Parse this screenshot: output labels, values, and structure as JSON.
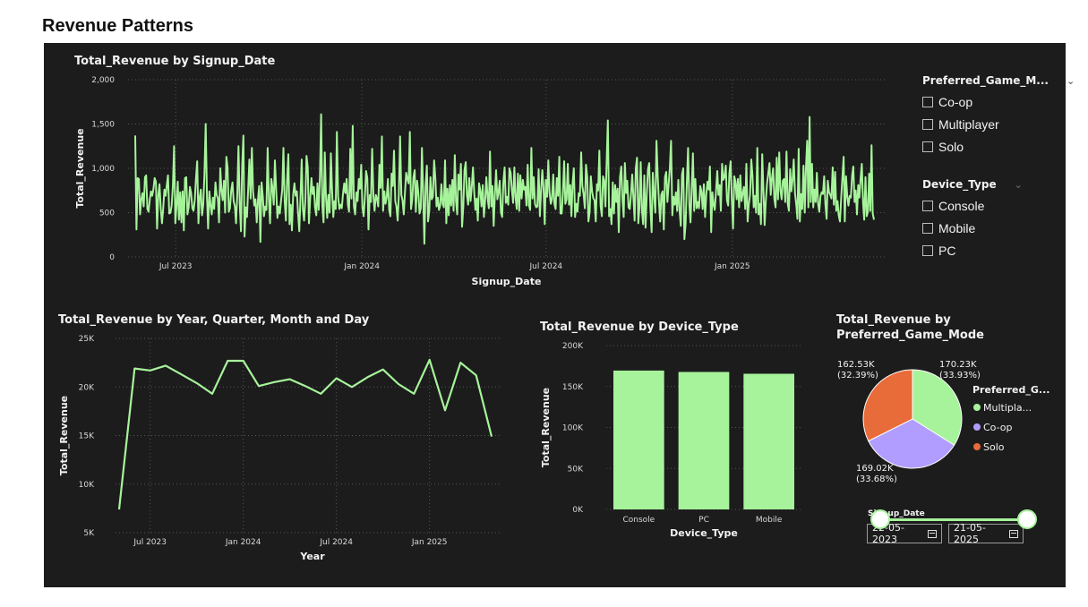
{
  "page": {
    "title": "Revenue Patterns"
  },
  "colors": {
    "green": "#a7f39b",
    "purple": "#b19cff",
    "orange": "#e86b3a",
    "background": "#1c1c1c"
  },
  "slicers": {
    "game_mode": {
      "title": "Preferred_Game_M...",
      "items": [
        "Co-op",
        "Multiplayer",
        "Solo"
      ]
    },
    "device_type": {
      "title": "Device_Type",
      "items": [
        "Console",
        "Mobile",
        "PC"
      ]
    },
    "signup_date": {
      "title": "Signup_Date",
      "start": "22-05-2023",
      "end": "21-05-2025"
    }
  },
  "chart_data": [
    {
      "id": "revenue-by-signup-date",
      "type": "line",
      "title": "Total_Revenue by Signup_Date",
      "xlabel": "Signup_Date",
      "ylabel": "Total_Revenue",
      "x_range": [
        "2023-05-22",
        "2025-05-21"
      ],
      "x_ticks": [
        "Jul 2023",
        "Jan 2024",
        "Jul 2024",
        "Jan 2025"
      ],
      "ylim": [
        0,
        2000
      ],
      "y_ticks": [
        "0",
        "500",
        "1,000",
        "1,500",
        "2,000"
      ],
      "series": [
        {
          "values": [
            1370,
            310,
            890,
            880,
            480,
            650,
            720,
            570,
            900,
            920,
            540,
            510,
            650,
            740,
            690,
            770,
            890,
            850,
            320,
            700,
            820,
            550,
            380,
            540,
            760,
            690,
            810,
            920,
            490,
            500,
            580,
            810,
            1250,
            380,
            570,
            850,
            420,
            730,
            390,
            740,
            300,
            890,
            900,
            480,
            560,
            790,
            720,
            550,
            520,
            640,
            880,
            1080,
            380,
            670,
            760,
            470,
            590,
            930,
            1500,
            690,
            320,
            740,
            590,
            480,
            670,
            540,
            840,
            700,
            660,
            390,
            1000,
            760,
            640,
            860,
            500,
            1130,
            1010,
            510,
            550,
            750,
            840,
            630,
            570,
            380,
            710,
            1250,
            600,
            290,
            1020,
            1370,
            230,
            560,
            450,
            780,
            1100,
            660,
            1230,
            740,
            580,
            650,
            390,
            630,
            800,
            170,
            840,
            680,
            460,
            570,
            530,
            1230,
            650,
            380,
            880,
            780,
            590,
            1090,
            760,
            440,
            570,
            490,
            630,
            760,
            1230,
            630,
            410,
            870,
            1160,
            370,
            590,
            300,
            700,
            830,
            690,
            740,
            500,
            290,
            650,
            1100,
            530,
            410,
            640,
            1140,
            1010,
            380,
            660,
            890,
            710,
            790,
            560,
            470,
            830,
            530,
            910,
            1610,
            570,
            390,
            1180,
            680,
            440,
            700,
            500,
            1170,
            760,
            450,
            630,
            540,
            1410,
            680,
            540,
            590,
            550,
            710,
            830,
            720,
            880,
            590,
            510,
            1220,
            660,
            1480,
            570,
            480,
            730,
            630,
            880,
            770,
            1040,
            560,
            460,
            680,
            970,
            890,
            310,
            700,
            620,
            1220,
            690,
            520,
            700,
            660,
            570,
            1040,
            780,
            1360,
            520,
            740,
            600,
            680,
            880,
            530,
            460,
            940,
            800,
            1200,
            630,
            570,
            410,
            700,
            1360,
            700,
            640,
            480,
            720,
            950,
            880,
            830,
            1410,
            540,
            650,
            900,
            980,
            510,
            860,
            720,
            490,
            550,
            1230,
            700,
            150,
            800,
            1030,
            400,
            520,
            900,
            650,
            680,
            1090,
            880,
            570,
            670,
            530,
            580,
            820,
            600,
            560,
            1090,
            380,
            770,
            470,
            810,
            580,
            870,
            520,
            1150,
            630,
            480,
            930,
            760,
            1050,
            340,
            570,
            980,
            1070,
            700,
            590,
            890,
            630,
            800,
            1010,
            720,
            530,
            660,
            410,
            830,
            750,
            570,
            810,
            450,
            640,
            900,
            670,
            550,
            1190,
            570,
            800,
            350,
            690,
            980,
            650,
            730,
            860,
            500,
            450,
            840,
            1010,
            610,
            680,
            590,
            1000,
            950,
            760,
            610,
            1010,
            670,
            540,
            940,
            520,
            920,
            660,
            870,
            760,
            790,
            580,
            1040,
            590,
            530,
            1230,
            660,
            900,
            600,
            560,
            570,
            990,
            460,
            740,
            980,
            790,
            370,
            870,
            680,
            1090,
            730,
            600,
            650,
            930,
            600,
            540,
            890,
            690,
            1130,
            490,
            490,
            720,
            1080,
            600,
            650,
            1050,
            590,
            810,
            460,
            840,
            1000,
            450,
            600,
            510,
            720,
            690,
            1180,
            800,
            710,
            550,
            1040,
            900,
            400,
            510,
            910,
            740,
            660,
            640,
            400,
            820,
            750,
            1200,
            580,
            460,
            910,
            860,
            570,
            1090,
            1540,
            460,
            540,
            370,
            840,
            490,
            810,
            620,
            770,
            280,
            900,
            1020,
            660,
            450,
            1060,
            720,
            860,
            560,
            540,
            700,
            930,
            680,
            410,
            1000,
            1120,
            380,
            560,
            1070,
            530,
            370,
            920,
            330,
            710,
            990,
            1060,
            560,
            280,
            950,
            700,
            500,
            1310,
            910,
            640,
            400,
            700,
            740,
            310,
            900,
            960,
            620,
            820,
            1000,
            1310,
            470,
            680,
            590,
            730,
            520,
            870,
            520,
            350,
            930,
            1000,
            200,
            380,
            830,
            1230,
            590,
            390,
            790,
            1170,
            520,
            880,
            550,
            620,
            550,
            800,
            740,
            540,
            820,
            450,
            700,
            850,
            760,
            1020,
            280,
            730,
            590,
            530,
            740,
            970,
            700,
            810,
            520,
            1050,
            870,
            900,
            1030,
            640,
            580,
            940,
            1080,
            650,
            320,
            910,
            850,
            650,
            880,
            560,
            920,
            630,
            720,
            790,
            540,
            1050,
            400,
            590,
            700,
            1100,
            920,
            560,
            690,
            500,
            1230,
            480,
            600,
            370,
            1160,
            760,
            360,
            630,
            830,
            940,
            1060,
            700,
            880,
            1000,
            660,
            560,
            1120,
            650,
            1180,
            750,
            650,
            860,
            880,
            620,
            1190,
            600,
            520,
            990,
            740,
            870,
            1100,
            720,
            590,
            430,
            1220,
            400,
            710,
            540,
            1030,
            500,
            1000,
            1310,
            560,
            1580,
            620,
            1050,
            560,
            760,
            620,
            950,
            600,
            510,
            690,
            730,
            710,
            910,
            600,
            430,
            860,
            730,
            700,
            660,
            1010,
            590,
            960,
            520,
            630,
            470,
            400,
            670,
            890,
            1130,
            400,
            910,
            690,
            580,
            690,
            670,
            920,
            1020,
            620,
            750,
            480,
            810,
            670,
            890,
            1050,
            610,
            420,
            900,
            460,
            510,
            940,
            520,
            1260,
            490,
            420
          ]
        }
      ]
    },
    {
      "id": "revenue-by-year-quarter-month-day",
      "type": "line",
      "title": "Total_Revenue by Year, Quarter, Month and Day",
      "xlabel": "Year",
      "ylabel": "Total_Revenue",
      "x": [
        "May 2023",
        "Jun 2023",
        "Jul 2023",
        "Aug 2023",
        "Sep 2023",
        "Oct 2023",
        "Nov 2023",
        "Dec 2023",
        "Jan 2024",
        "Feb 2024",
        "Mar 2024",
        "Apr 2024",
        "May 2024",
        "Jun 2024",
        "Jul 2024",
        "Aug 2024",
        "Sep 2024",
        "Oct 2024",
        "Nov 2024",
        "Dec 2024",
        "Jan 2025",
        "Feb 2025",
        "Mar 2025",
        "Apr 2025",
        "May 2025"
      ],
      "x_ticks": [
        "Jul 2023",
        "Jan 2024",
        "Jul 2024",
        "Jan 2025"
      ],
      "ylim": [
        5000,
        25000
      ],
      "y_ticks": [
        "5K",
        "10K",
        "15K",
        "20K",
        "25K"
      ],
      "series": [
        {
          "values": [
            7400,
            21900,
            21700,
            22200,
            21300,
            20400,
            19300,
            22700,
            22700,
            20100,
            20500,
            20800,
            20100,
            19300,
            20900,
            20000,
            21000,
            21800,
            20300,
            19300,
            22800,
            17600,
            22500,
            21200,
            14900
          ]
        }
      ]
    },
    {
      "id": "revenue-by-device-type",
      "type": "bar",
      "title": "Total_Revenue by Device_Type",
      "xlabel": "Device_Type",
      "ylabel": "Total_Revenue",
      "categories": [
        "Console",
        "PC",
        "Mobile"
      ],
      "values": [
        169500,
        167800,
        165600
      ],
      "ylim": [
        0,
        200000
      ],
      "y_ticks": [
        "0K",
        "50K",
        "100K",
        "150K",
        "200K"
      ]
    },
    {
      "id": "revenue-by-preferred-game-mode",
      "type": "pie",
      "title": "Total_Revenue by Preferred_Game_Mode",
      "legend_title": "Preferred_G...",
      "legend_position": "right",
      "categories": [
        "Multiplayer",
        "Co-op",
        "Solo"
      ],
      "legend_labels": [
        "Multipla...",
        "Co-op",
        "Solo"
      ],
      "values": [
        170230,
        169020,
        162530
      ],
      "data_labels": [
        "170.23K\n(33.93%)",
        "169.02K\n(33.68%)",
        "162.53K\n(32.39%)"
      ],
      "colors": [
        "#a7f39b",
        "#b19cff",
        "#e86b3a"
      ]
    }
  ]
}
